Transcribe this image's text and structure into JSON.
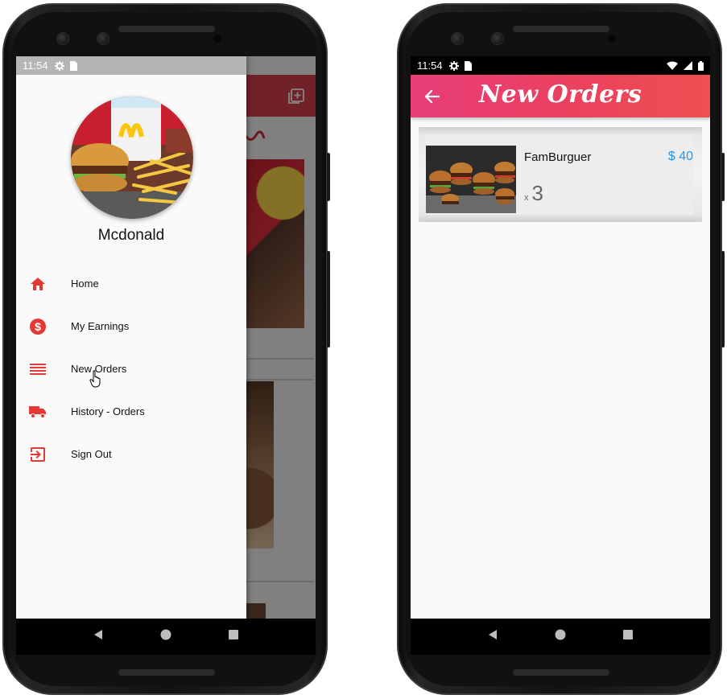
{
  "status_bar": {
    "time": "11:54"
  },
  "drawer": {
    "profile_name": "Mcdonald",
    "items": [
      {
        "label": "Home",
        "icon": "home-icon"
      },
      {
        "label": "My Earnings",
        "icon": "dollar-circle-icon"
      },
      {
        "label": "New Orders",
        "icon": "list-icon"
      },
      {
        "label": "History - Orders",
        "icon": "truck-icon"
      },
      {
        "label": "Sign Out",
        "icon": "exit-icon"
      }
    ]
  },
  "orders_screen": {
    "title": "New Orders",
    "orders": [
      {
        "name": "FamBurguer",
        "price": "$ 40",
        "qty_prefix": "x",
        "qty": "3"
      }
    ]
  },
  "colors": {
    "accent_red": "#e53935",
    "appbar_gradient_start": "#e83d7a",
    "appbar_gradient_end": "#ef5050",
    "price_blue": "#2196f3"
  }
}
